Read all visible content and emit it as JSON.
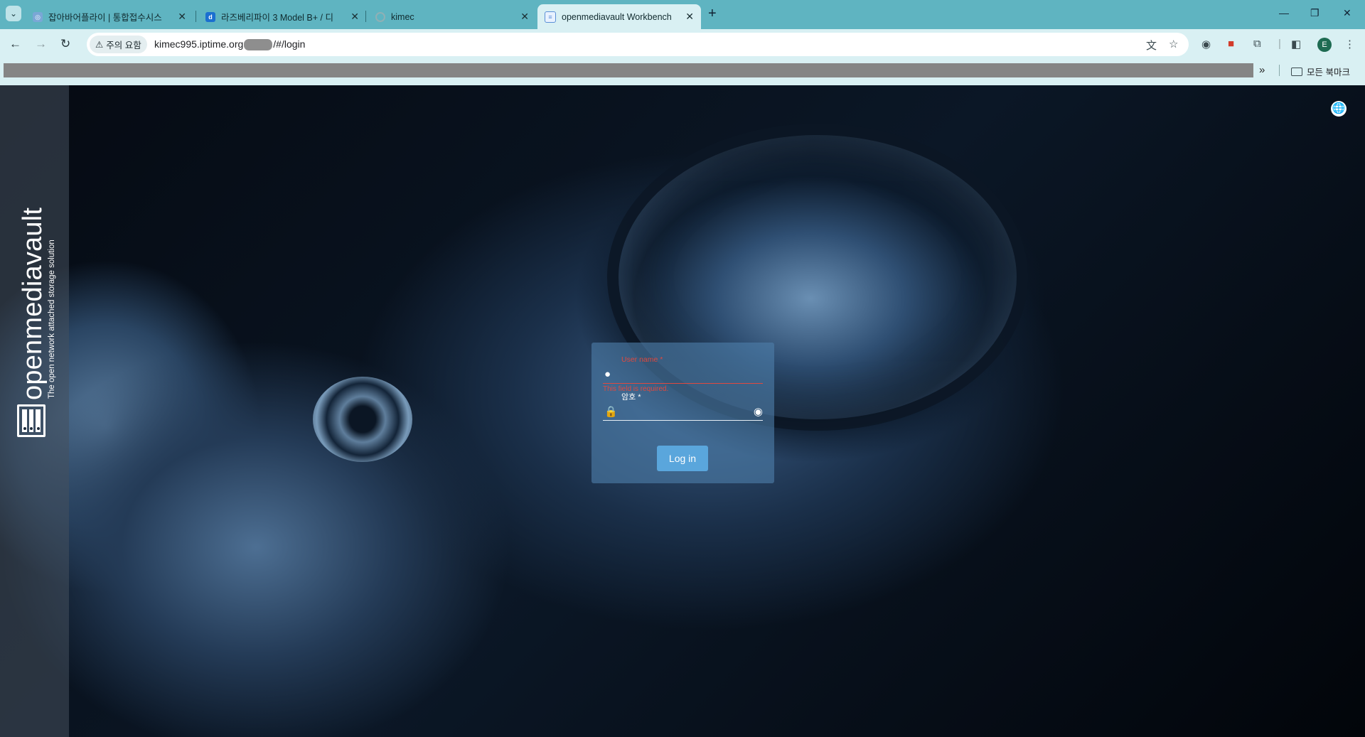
{
  "browser": {
    "tabs": [
      {
        "title": "잡아바어플라이 | 통합접수시스",
        "favicon": "globe-favicon-icon",
        "active": false
      },
      {
        "title": "라즈베리파이 3 Model B+ / 디",
        "favicon": "dvi-favicon-icon",
        "active": false
      },
      {
        "title": "kimec",
        "favicon": "loading-favicon-icon",
        "active": false
      },
      {
        "title": "openmediavault Workbench",
        "favicon": "doc-favicon-icon",
        "active": true
      }
    ],
    "security_chip": "주의 요함",
    "url_prefix": "kimec995.iptime.org",
    "url_suffix": "/#/login",
    "bookmarks_folder": "모든 북마크",
    "profile_initial": "E",
    "theme_color": "#5fb4c1"
  },
  "app": {
    "brand_name": "openmediavault",
    "brand_tagline": "The open network attached storage solution",
    "login": {
      "username_label": "User name *",
      "username_error": "This field is required.",
      "password_label": "암호 *",
      "login_button": "Log in"
    }
  }
}
